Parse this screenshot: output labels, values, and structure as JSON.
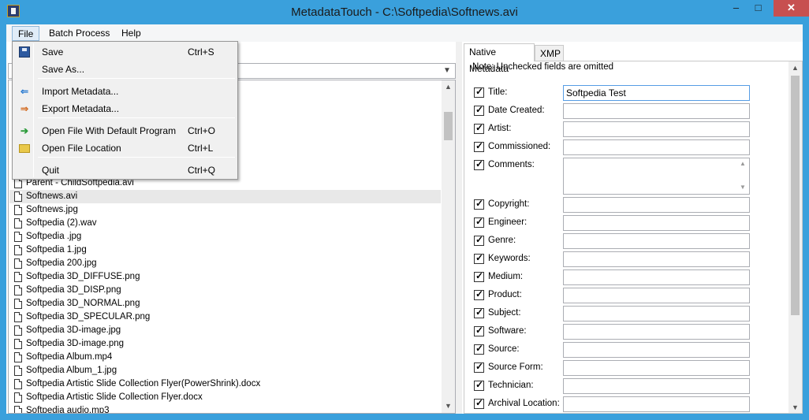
{
  "window": {
    "title": "MetadataTouch - C:\\Softpedia\\Softnews.avi",
    "minimize_glyph": "‒",
    "maximize_glyph": "□",
    "close_glyph": "✕",
    "titlebar_color": "#3aa0dc"
  },
  "menubar": {
    "file": "File",
    "batch": "Batch Process",
    "help": "Help"
  },
  "file_menu": {
    "items": [
      {
        "label": "Save",
        "shortcut": "Ctrl+S",
        "icon": "save-icon"
      },
      {
        "label": "Save As...",
        "shortcut": "",
        "icon": ""
      },
      {
        "label": "Import Metadata...",
        "shortcut": "",
        "icon": "import-icon"
      },
      {
        "label": "Export Metadata...",
        "shortcut": "",
        "icon": "export-icon"
      },
      {
        "label": "Open File With Default Program",
        "shortcut": "Ctrl+O",
        "icon": "open-arrow-icon"
      },
      {
        "label": "Open File Location",
        "shortcut": "Ctrl+L",
        "icon": "folder-icon"
      },
      {
        "label": "Quit",
        "shortcut": "Ctrl+Q",
        "icon": ""
      }
    ]
  },
  "file_list": {
    "items": [
      "Parent - ChildSoftpedia.avi",
      "Softnews.avi",
      "Softnews.jpg",
      "Softpedia (2).wav",
      "Softpedia .jpg",
      "Softpedia 1.jpg",
      "Softpedia 200.jpg",
      "Softpedia 3D_DIFFUSE.png",
      "Softpedia 3D_DISP.png",
      "Softpedia 3D_NORMAL.png",
      "Softpedia 3D_SPECULAR.png",
      "Softpedia 3D-image.jpg",
      "Softpedia 3D-image.png",
      "Softpedia Album.mp4",
      "Softpedia Album_1.jpg",
      "Softpedia Artistic Slide Collection Flyer(PowerShrink).docx",
      "Softpedia Artistic Slide Collection Flyer.docx",
      "Softpedia audio.mp3"
    ],
    "selected": "Softnews.avi"
  },
  "tabs": {
    "native": "Native Metadata",
    "xmp": "XMP"
  },
  "metadata": {
    "note": "Note: Unchecked fields are omitted",
    "fields": [
      {
        "label": "Title:",
        "value": "Softpedia Test"
      },
      {
        "label": "Date Created:",
        "value": ""
      },
      {
        "label": "Artist:",
        "value": ""
      },
      {
        "label": "Commissioned:",
        "value": ""
      },
      {
        "label": "Comments:",
        "value": ""
      },
      {
        "label": "Copyright:",
        "value": ""
      },
      {
        "label": "Engineer:",
        "value": ""
      },
      {
        "label": "Genre:",
        "value": ""
      },
      {
        "label": "Keywords:",
        "value": ""
      },
      {
        "label": "Medium:",
        "value": ""
      },
      {
        "label": "Product:",
        "value": ""
      },
      {
        "label": "Subject:",
        "value": ""
      },
      {
        "label": "Software:",
        "value": ""
      },
      {
        "label": "Source:",
        "value": ""
      },
      {
        "label": "Source Form:",
        "value": ""
      },
      {
        "label": "Technician:",
        "value": ""
      },
      {
        "label": "Archival Location:",
        "value": ""
      }
    ]
  }
}
